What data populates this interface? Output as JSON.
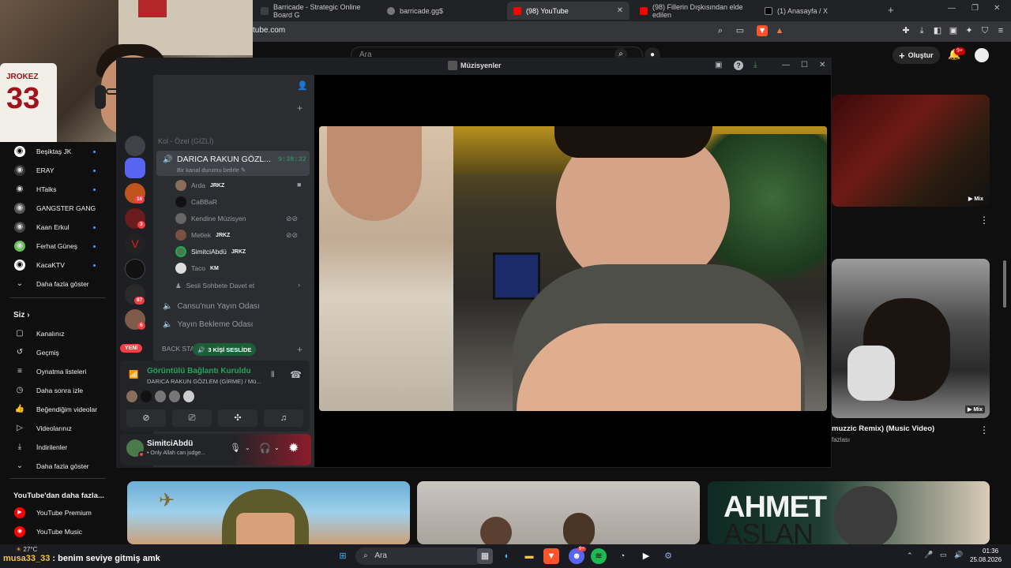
{
  "browser": {
    "tabs": [
      {
        "title": "Barricade - Strategic Online Board G"
      },
      {
        "title": "barricade.gg$"
      },
      {
        "title": "(98) YouTube"
      },
      {
        "title": "(98) Fillerin Dışkısından elde edilen"
      },
      {
        "title": "(1) Anasayfa / X"
      }
    ],
    "url": "tube.com"
  },
  "youtube": {
    "search_placeholder": "Ara",
    "create_label": "Oluştur",
    "notif_count": "9+",
    "sidebar": {
      "subscriptions": [
        {
          "label": "Beşiktaş JK"
        },
        {
          "label": "ERAY"
        },
        {
          "label": "HTalks"
        },
        {
          "label": "GANGSTER GANG"
        },
        {
          "label": "Kaan Erkul"
        },
        {
          "label": "Ferhat Güneş"
        },
        {
          "label": "KacaKTV"
        }
      ],
      "show_more": "Daha fazla göster",
      "you_section": "Siz",
      "you_items": [
        {
          "label": "Kanalınız"
        },
        {
          "label": "Geçmiş"
        },
        {
          "label": "Oynatma listeleri"
        },
        {
          "label": "Daha sonra izle"
        },
        {
          "label": "Beğendiğim videolar"
        },
        {
          "label": "Videolarınız"
        },
        {
          "label": "İndirilenler"
        },
        {
          "label": "Daha fazla göster"
        }
      ],
      "more_section": "YouTube'dan daha fazla...",
      "more_items": [
        {
          "label": "YouTube Premium"
        },
        {
          "label": "YouTube Music"
        }
      ]
    },
    "right_cards": [
      {
        "badge": "Mix"
      },
      {
        "badge": "Mix",
        "title": "muzzic Remix) (Music Video)",
        "sub": "fazlası"
      }
    ],
    "bottom_thumb_text": {
      "line1": "AHMET",
      "line2": "ASLAN"
    }
  },
  "webcam": {
    "jersey_name": "JROKEZ",
    "jersey_number": "33"
  },
  "discord": {
    "window_title": "Müzisyenler",
    "partial_channel": "Kol - Özel (GİZLİ)",
    "active_channel": "DARICA RAKUN GÖZL...",
    "active_timer": "9:38:32",
    "status_prompt": "Bir kanal durumu belirle",
    "members": [
      {
        "name": "Arda",
        "tag": "JRKZ"
      },
      {
        "name": "CaBBaR",
        "tag": ""
      },
      {
        "name": "Kendine Müzisyen",
        "tag": ""
      },
      {
        "name": "Metlek",
        "tag": "JRKZ"
      },
      {
        "name": "SimitciAbdü",
        "tag": "JRKZ"
      },
      {
        "name": "Taco",
        "tag": "KM"
      }
    ],
    "invite_label": "Sesli Sohbete Davet et",
    "other_channels": [
      "Cansu'nun Yayın Odası",
      "Yayın Bekleme Odası"
    ],
    "back_stage": "BACK STA",
    "voice_count": "3 KİŞİ SESLİDE",
    "new_label": "YENİ",
    "guild_badges": [
      "16",
      "3",
      "87",
      "6"
    ],
    "rtc_status": "Görüntülü Bağlantı Kuruldu",
    "rtc_channel": "DARICA RAKUN GÖZLEM (GİRME) / Mü...",
    "user_name": "SimitciAbdü",
    "user_status": "Only Allah can judge..."
  },
  "taskbar": {
    "weather": "27°C",
    "search": "Ara",
    "time": "01:36",
    "date": "25.08.2026",
    "discord_badge": "9+"
  },
  "stream_chat": {
    "user": "musa33_33",
    "message": ": benim seviye gitmiş amk"
  },
  "colors": {
    "yt_bg": "#0f0f0f",
    "discord_bg": "#313338",
    "discord_green": "#23a55a",
    "yt_red": "#ff0000"
  }
}
